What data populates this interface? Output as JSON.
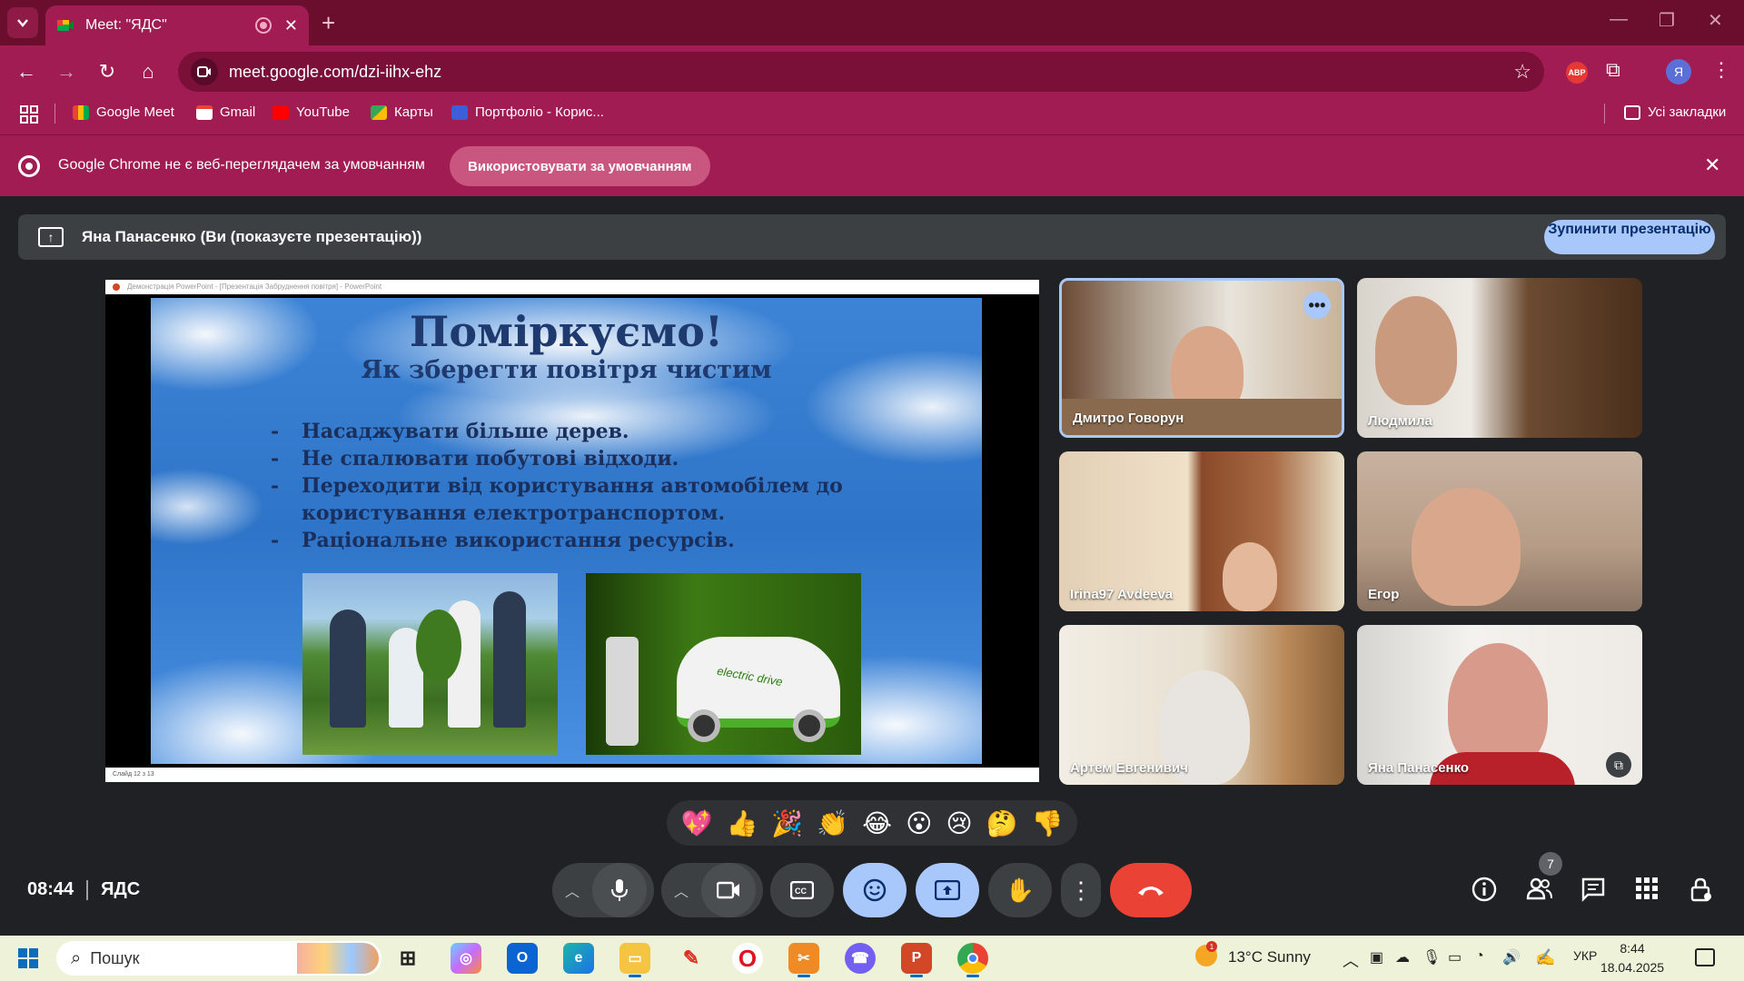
{
  "browser": {
    "tab_title": "Meet: \"ЯДС\"",
    "url": "meet.google.com/dzi-iihx-ehz",
    "profile_initial": "Я",
    "abp_label": "ABP",
    "bookmarks": [
      "Google Meet",
      "Gmail",
      "YouTube",
      "Карты",
      "Портфоліо - Корис..."
    ],
    "all_bookmarks": "Усі закладки",
    "infobar_message": "Google Chrome не є веб-переглядачем за умовчанням",
    "infobar_button": "Використовувати за умовчанням"
  },
  "meet": {
    "presenting_banner": "Яна Панасенко (Ви (показуєте презентацію))",
    "stop_button": "Зупинити презентацію",
    "slide": {
      "window_title": "Демонстрація PowerPoint - [Презентація Забруднення повітря] - PowerPoint",
      "status_text": "Слайд 12 з 13",
      "heading": "Поміркуємо!",
      "subheading": "Як зберегти повітря чистим",
      "bullets": [
        "Насаджувати більше дерев.",
        "Не спалювати побутові відходи.",
        "Переходити від користування автомобілем до користування електротранспортом.",
        "Раціональне використання ресурсів."
      ],
      "car_text": "electric drive"
    },
    "participants": [
      {
        "name": "Дмитро Говорун"
      },
      {
        "name": "Людмила"
      },
      {
        "name": "Irina97 Avdeeva"
      },
      {
        "name": "Егор"
      },
      {
        "name": "Артем Евгенивич"
      },
      {
        "name": "Яна Панасенко"
      }
    ],
    "reactions": [
      "💖",
      "👍",
      "🎉",
      "👏",
      "😂",
      "😮",
      "😢",
      "🤔",
      "👎"
    ],
    "time": "08:44",
    "meeting_name": "ЯДС",
    "people_count": "7"
  },
  "taskbar": {
    "search_placeholder": "Пошук",
    "weather": "13°C  Sunny",
    "weather_badge": "1",
    "language": "УКР",
    "time": "8:44",
    "date": "18.04.2025"
  },
  "colors": {
    "tabstrip": "#6b0e2e",
    "toolbar": "#a01c52",
    "meet_bg": "#202124",
    "accent_blue": "#a8c7fa",
    "end_call_red": "#ea4335"
  }
}
